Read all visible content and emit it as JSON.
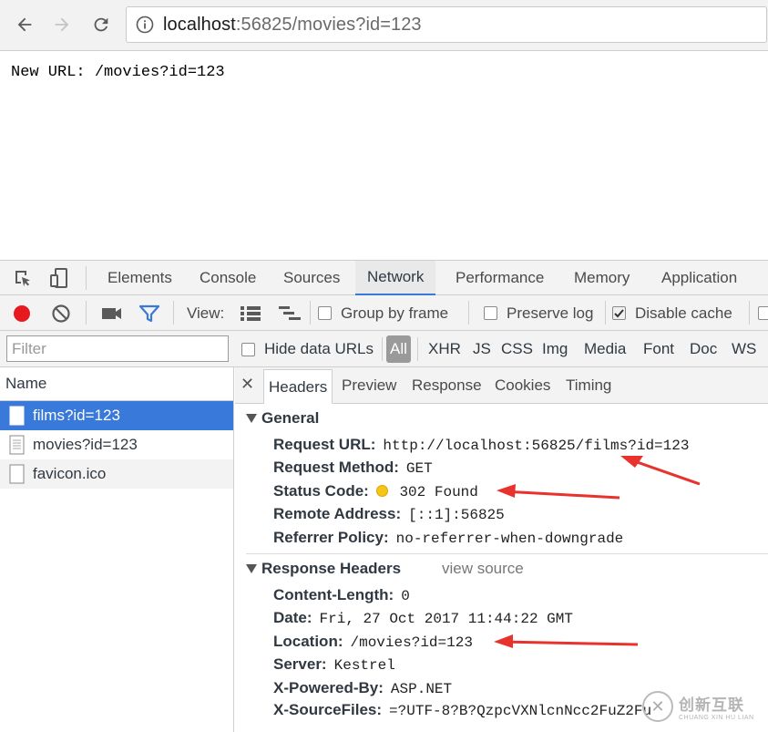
{
  "browser": {
    "url_host": "localhost",
    "url_rest": ":56825/movies?id=123"
  },
  "page": {
    "text": "New URL: /movies?id=123"
  },
  "devtools": {
    "tabs": [
      "Elements",
      "Console",
      "Sources",
      "Network",
      "Performance",
      "Memory",
      "Application"
    ],
    "active_tab": "Network",
    "toolbar": {
      "view_label": "View:",
      "group_by_frame": "Group by frame",
      "preserve_log": "Preserve log",
      "disable_cache": "Disable cache",
      "disable_cache_checked": true
    },
    "filter": {
      "placeholder": "Filter",
      "hide_data_urls": "Hide data URLs",
      "types": [
        "All",
        "XHR",
        "JS",
        "CSS",
        "Img",
        "Media",
        "Font",
        "Doc",
        "WS"
      ]
    },
    "requests": {
      "header": "Name",
      "items": [
        "films?id=123",
        "movies?id=123",
        "favicon.ico"
      ]
    },
    "details": {
      "tabs": [
        "Headers",
        "Preview",
        "Response",
        "Cookies",
        "Timing"
      ],
      "general": {
        "title": "General",
        "rows": [
          {
            "k": "Request URL:",
            "v": "http://localhost:56825/films?id=123"
          },
          {
            "k": "Request Method:",
            "v": "GET"
          },
          {
            "k": "Status Code:",
            "v": "302 Found"
          },
          {
            "k": "Remote Address:",
            "v": "[::1]:56825"
          },
          {
            "k": "Referrer Policy:",
            "v": "no-referrer-when-downgrade"
          }
        ]
      },
      "response_headers": {
        "title": "Response Headers",
        "view_source": "view source",
        "rows": [
          {
            "k": "Content-Length:",
            "v": "0"
          },
          {
            "k": "Date:",
            "v": "Fri, 27 Oct 2017 11:44:22 GMT"
          },
          {
            "k": "Location:",
            "v": "/movies?id=123"
          },
          {
            "k": "Server:",
            "v": "Kestrel"
          },
          {
            "k": "X-Powered-By:",
            "v": "ASP.NET"
          },
          {
            "k": "X-SourceFiles:",
            "v": "=?UTF-8?B?QzpcVXNlcnNcc2FuZ2Fu"
          }
        ]
      }
    }
  },
  "watermark": {
    "cn": "创新互联",
    "en": "CHUANG XIN HU LIAN"
  },
  "colors": {
    "accent": "#3879d9",
    "record": "#e5191e",
    "arrow": "#e8322d"
  }
}
